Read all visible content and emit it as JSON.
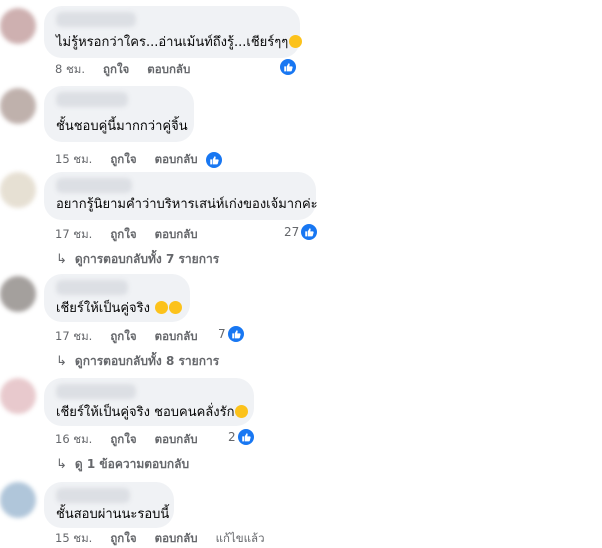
{
  "comments": [
    {
      "text": "ไม่รู้หรอกว่าใคร...อ่านเม้นท์ถึงรู้...เชียร์ๆๆ",
      "emoji": "😊",
      "time": "8 ชม.",
      "like_label": "ถูกใจ",
      "reply_label": "ตอบกลับ",
      "reaction_count": "",
      "avatar_color": "#c9a8a8"
    },
    {
      "text": "ชั้นชอบคู่นี้มากกว่าคู่จิ้น",
      "emoji": "",
      "time": "15 ชม.",
      "like_label": "ถูกใจ",
      "reply_label": "ตอบกลับ",
      "reaction_count": "",
      "avatar_color": "#b9a9a4"
    },
    {
      "text": "อยากรู้นิยามคำว่าบริหารเสน่ห์เก่งของเจ้มากค่ะ",
      "emoji": "",
      "time": "17 ชม.",
      "like_label": "ถูกใจ",
      "reply_label": "ตอบกลับ",
      "reaction_count": "27",
      "view_replies": "ดูการตอบกลับทั้ง 7 รายการ",
      "avatar_color": "#e4ddcf"
    },
    {
      "text": "เชียร์ให้เป็นคู่จริง",
      "emoji": "😂😂",
      "time": "17 ชม.",
      "like_label": "ถูกใจ",
      "reply_label": "ตอบกลับ",
      "reaction_count": "7",
      "view_replies": "ดูการตอบกลับทั้ง 8 รายการ",
      "avatar_color": "#9b9693"
    },
    {
      "text": "เชียร์ให้เป็นคู่จริง ชอบคนคลั่งรัก",
      "emoji": "🥰",
      "time": "16 ชม.",
      "like_label": "ถูกใจ",
      "reply_label": "ตอบกลับ",
      "reaction_count": "2",
      "view_replies": "ดู 1 ข้อความตอบกลับ",
      "avatar_color": "#e6c4c8"
    },
    {
      "text": "ชั้นสอบผ่านนะรอบนี้",
      "emoji": "",
      "time": "15 ชม.",
      "like_label": "ถูกใจ",
      "reply_label": "ตอบกลับ",
      "edited_label": "แก้ไขแล้ว",
      "reaction_count": "",
      "avatar_color": "#a8c0d6"
    }
  ],
  "colors": {
    "bubble": "#f0f2f5",
    "meta_text": "#65676b",
    "like_blue": "#1877f2"
  }
}
